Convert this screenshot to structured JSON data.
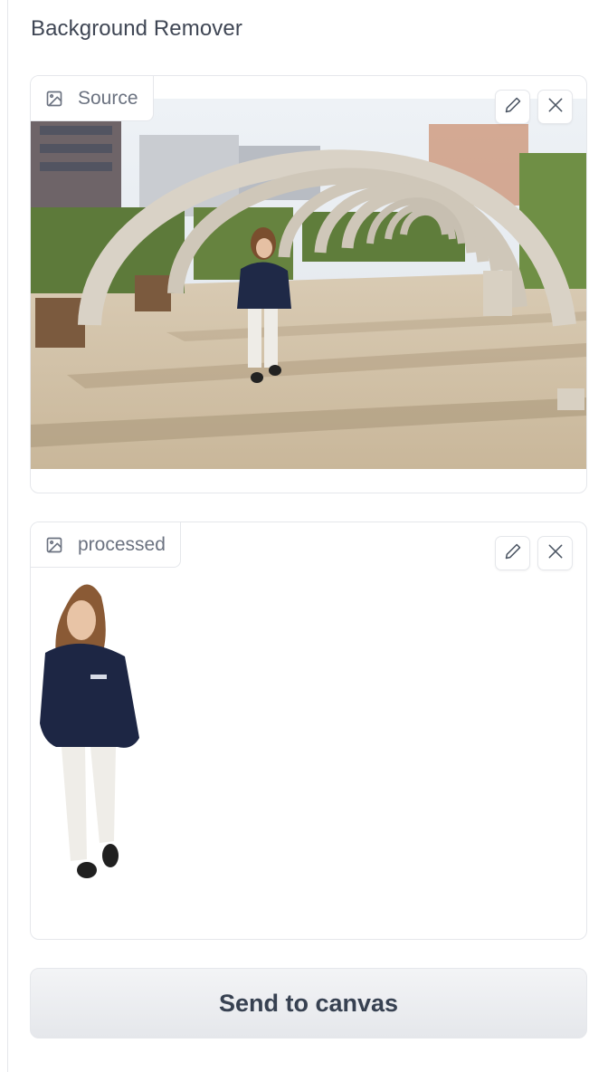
{
  "app": {
    "title": "Background Remover"
  },
  "source": {
    "label": "Source",
    "label_icon": "image-icon",
    "actions": [
      {
        "name": "edit",
        "icon": "pencil-icon"
      },
      {
        "name": "clear",
        "icon": "close-icon"
      }
    ]
  },
  "processed": {
    "label": "processed",
    "label_icon": "image-icon",
    "actions": [
      {
        "name": "edit",
        "icon": "pencil-icon"
      },
      {
        "name": "clear",
        "icon": "close-icon"
      }
    ]
  },
  "actions": {
    "send_label": "Send to canvas"
  },
  "colors": {
    "border": "#e5e7eb",
    "text": "#374151",
    "muted": "#6b7280",
    "button_bg": "#e5e7eb"
  }
}
